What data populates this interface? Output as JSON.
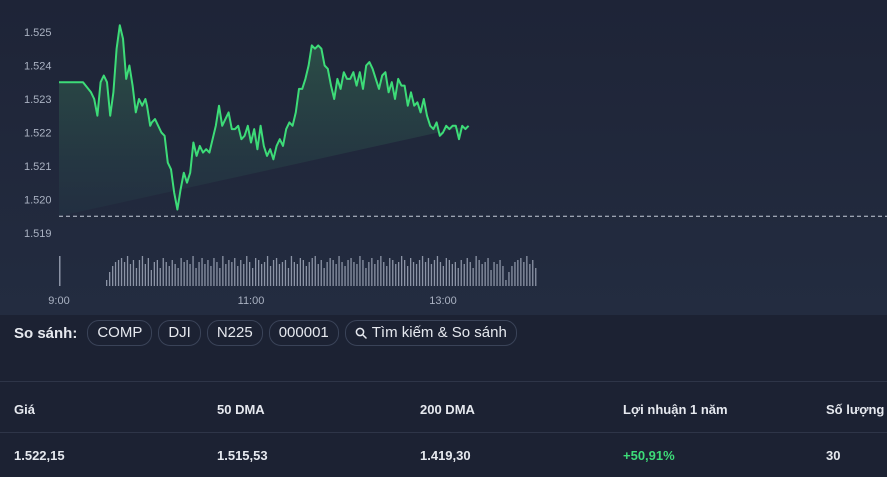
{
  "chart_data": {
    "type": "area",
    "title": "",
    "xlabel": "",
    "ylabel": "",
    "ylim": [
      1.5185,
      1.5255
    ],
    "y_ticks": [
      "1.525",
      "1.524",
      "1.523",
      "1.522",
      "1.521",
      "1.520",
      "1.519"
    ],
    "x_ticks": [
      "9:00",
      "11:00",
      "13:00"
    ],
    "previous_close": 1.5195,
    "line_color": "#3ddc78",
    "series": [
      {
        "x_minutes": [
          0,
          15,
          20,
          22,
          24,
          26,
          28,
          30,
          32,
          34,
          36,
          38,
          40,
          42,
          43,
          44,
          46,
          48,
          50,
          52,
          54,
          55,
          56,
          57,
          58,
          60,
          62,
          64,
          66,
          68,
          70,
          72,
          74,
          76,
          78,
          80,
          82,
          84,
          86,
          88,
          90,
          92,
          94,
          96,
          98,
          100,
          102,
          104,
          106,
          108,
          110,
          112,
          114,
          116,
          118,
          120,
          122,
          124,
          126,
          128,
          130,
          132,
          134,
          136,
          138,
          140,
          142,
          144,
          146,
          148,
          150,
          152,
          154,
          156,
          158,
          160,
          162,
          164,
          166,
          168,
          170,
          172,
          174,
          176,
          178,
          180,
          182,
          184,
          186,
          188,
          190,
          192,
          194,
          196,
          198,
          200,
          202,
          204,
          206,
          208,
          210,
          212,
          214,
          216,
          218,
          220,
          222,
          224,
          226,
          228,
          230,
          232,
          234,
          236,
          238,
          240,
          242,
          244,
          246,
          248,
          250,
          252,
          254,
          256,
          258,
          260,
          262,
          264,
          266,
          268,
          270,
          272,
          274,
          276,
          278,
          280,
          282,
          284,
          286,
          288,
          290,
          292,
          294,
          296,
          298,
          300,
          302,
          304,
          306,
          308
        ],
        "values": [
          1.5235,
          1.5235,
          1.5232,
          1.523,
          1.5225,
          1.5235,
          1.5237,
          1.5235,
          1.5225,
          1.5232,
          1.5245,
          1.5252,
          1.5248,
          1.5236,
          1.5238,
          1.524,
          1.5234,
          1.5226,
          1.523,
          1.5228,
          1.523,
          1.5228,
          1.5225,
          1.5222,
          1.5223,
          1.5224,
          1.5222,
          1.522,
          1.5219,
          1.5211,
          1.5209,
          1.5202,
          1.5197,
          1.5203,
          1.5208,
          1.5205,
          1.5208,
          1.5217,
          1.5213,
          1.5216,
          1.5214,
          1.5215,
          1.5214,
          1.5218,
          1.5222,
          1.5228,
          1.5222,
          1.5224,
          1.5226,
          1.5221,
          1.5221,
          1.5222,
          1.5218,
          1.5219,
          1.5222,
          1.5217,
          1.5221,
          1.5215,
          1.5222,
          1.5216,
          1.5213,
          1.5215,
          1.5212,
          1.5216,
          1.5218,
          1.5216,
          1.5221,
          1.5223,
          1.5222,
          1.5226,
          1.5233,
          1.5233,
          1.5236,
          1.524,
          1.5246,
          1.5245,
          1.5246,
          1.5245,
          1.524,
          1.5239,
          1.5234,
          1.523,
          1.5236,
          1.5233,
          1.5238,
          1.5236,
          1.5236,
          1.5238,
          1.5234,
          1.5238,
          1.5233,
          1.524,
          1.5241,
          1.5239,
          1.5236,
          1.5233,
          1.5237,
          1.5238,
          1.5232,
          1.5235,
          1.523,
          1.5236,
          1.5234,
          1.5234,
          1.5228,
          1.5232,
          1.5228,
          1.5229,
          1.5226,
          1.523,
          1.5225,
          1.5222,
          1.5221,
          1.5223,
          1.5219,
          1.522,
          1.5222,
          1.5221,
          1.5222,
          1.5222,
          1.5218,
          1.5222,
          1.5221,
          1.5222
        ]
      }
    ]
  },
  "compare": {
    "label": "So sánh:",
    "chips": [
      "COMP",
      "DJI",
      "N225",
      "000001"
    ],
    "search_label": "Tìm kiếm & So sánh"
  },
  "stats": {
    "headers": [
      "Giá",
      "50 DMA",
      "200 DMA",
      "Lợi nhuận 1 năm",
      "Số lượng"
    ],
    "values": [
      "1.522,15",
      "1.515,53",
      "1.419,30",
      "+50,91%",
      "30"
    ],
    "positive_color": "#3ddc78"
  }
}
